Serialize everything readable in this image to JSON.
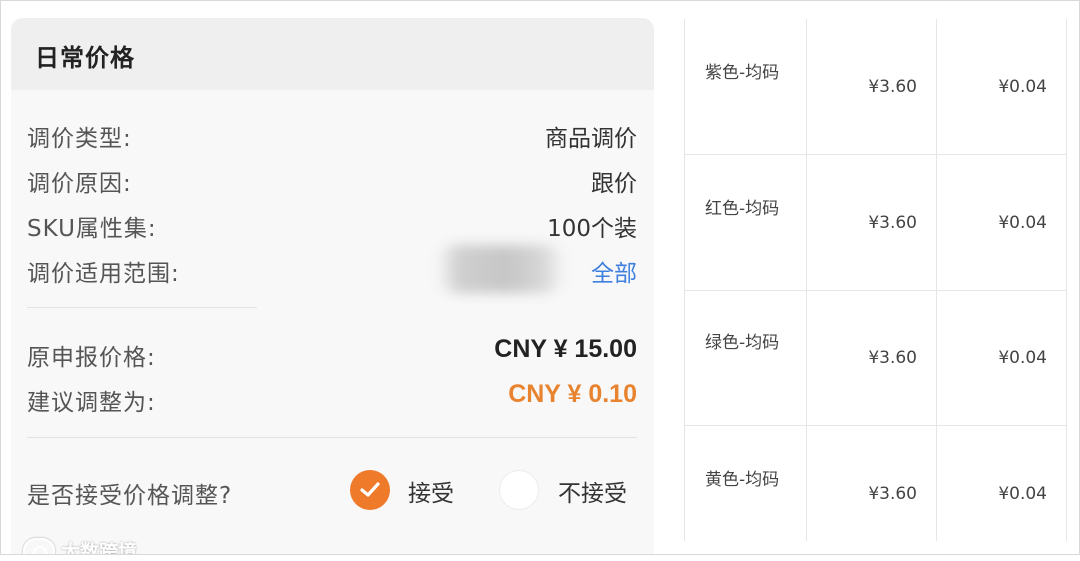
{
  "panel": {
    "title": "日常价格",
    "details": [
      {
        "label": "调价类型:",
        "value": "商品调价"
      },
      {
        "label": "调价原因:",
        "value": "跟价"
      },
      {
        "label": "SKU属性集:",
        "value": "100个装"
      },
      {
        "label": "调价适用范围:",
        "value": "全部"
      }
    ],
    "prices": {
      "original_label": "原申报价格:",
      "original_value": "CNY ¥ 15.00",
      "suggested_label": "建议调整为:",
      "suggested_value": "CNY ¥ 0.10"
    },
    "accept": {
      "question": "是否接受价格调整?",
      "accept_label": "接受",
      "reject_label": "不接受",
      "selected": "接受"
    }
  },
  "watermark": {
    "text": "大数跨境"
  },
  "table": {
    "rows": [
      {
        "variant": "紫色-均码",
        "price": "¥3.60",
        "diff": "¥0.04"
      },
      {
        "variant": "红色-均码",
        "price": "¥3.60",
        "diff": "¥0.04"
      },
      {
        "variant": "绿色-均码",
        "price": "¥3.60",
        "diff": "¥0.04"
      },
      {
        "variant": "黄色-均码",
        "price": "¥3.60",
        "diff": "¥0.04"
      }
    ]
  },
  "colors": {
    "accent_orange": "#ef7a2a",
    "link_blue": "#3f7fe0",
    "panel_bg": "#f8f8f8",
    "header_bg": "#efefef"
  },
  "icons": {
    "selected_radio": "checkmark-circle-icon",
    "unselected_radio": "empty-circle-icon",
    "watermark_logo": "brand-logo-icon"
  }
}
